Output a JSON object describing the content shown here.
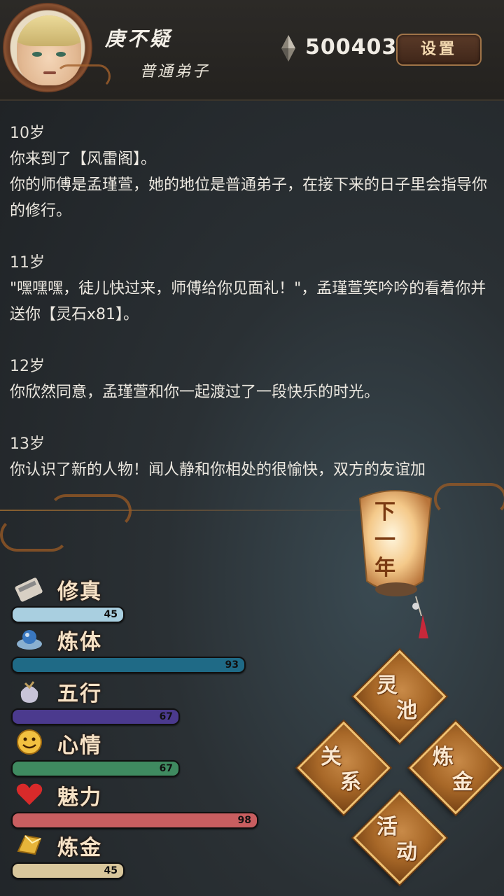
{
  "player": {
    "name": "庚不疑",
    "rank": "普通弟子",
    "currency": "500403"
  },
  "header": {
    "settings_label": "设置"
  },
  "log": [
    {
      "age": "10岁",
      "lines": [
        "你来到了【风雷阁】。",
        "你的师傅是孟瑾萱，她的地位是普通弟子，在接下来的日子里会指导你的修行。"
      ]
    },
    {
      "age": "11岁",
      "lines": [
        "\"嘿嘿嘿，徒儿快过来，师傅给你见面礼！\"，孟瑾萱笑吟吟的看着你并送你【灵石x81】。"
      ]
    },
    {
      "age": "12岁",
      "lines": [
        "你欣然同意，孟瑾萱和你一起渡过了一段快乐的时光。"
      ]
    },
    {
      "age": "13岁",
      "lines": [
        "你认识了新的人物！闻人静和你相处的很愉快，双方的友谊加"
      ]
    }
  ],
  "lantern": {
    "label": "下一年"
  },
  "stats": [
    {
      "key": "cultivation",
      "label": "修真",
      "value": 45,
      "max": 100,
      "icon": "book-icon",
      "color": "#a9cfe0"
    },
    {
      "key": "body",
      "label": "炼体",
      "value": 93,
      "max": 100,
      "icon": "cloud-orb-icon",
      "color": "#1f6a86"
    },
    {
      "key": "elements",
      "label": "五行",
      "value": 67,
      "max": 100,
      "icon": "pouch-icon",
      "color": "#4b3a8e"
    },
    {
      "key": "mood",
      "label": "心情",
      "value": 67,
      "max": 100,
      "icon": "smiley-icon",
      "color": "#3f8a60"
    },
    {
      "key": "charm",
      "label": "魅力",
      "value": 98,
      "max": 100,
      "icon": "heart-icon",
      "color": "#c85e60"
    },
    {
      "key": "alchemy",
      "label": "炼金",
      "value": 45,
      "max": 100,
      "icon": "gold-ingot-icon",
      "color": "#d9c79c"
    }
  ],
  "actions": [
    {
      "key": "spirit_pool",
      "c1": "灵",
      "c2": "池"
    },
    {
      "key": "relations",
      "c1": "关",
      "c2": "系"
    },
    {
      "key": "alchemy",
      "c1": "炼",
      "c2": "金"
    },
    {
      "key": "events",
      "c1": "活",
      "c2": "动"
    }
  ]
}
